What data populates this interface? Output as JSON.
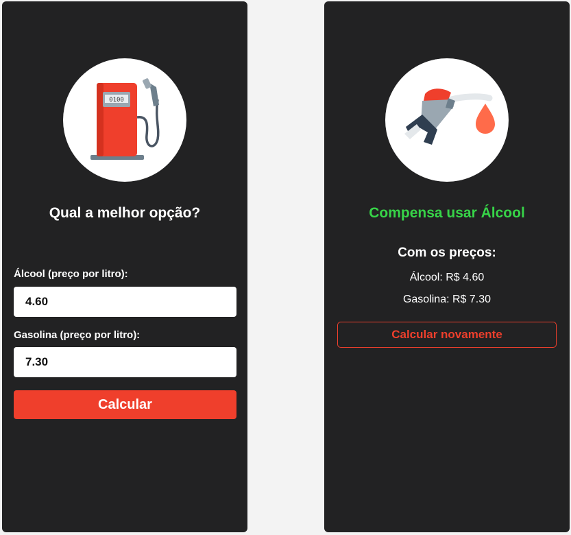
{
  "form_screen": {
    "icon": "gas-pump-icon",
    "pump_display": "0100",
    "title": "Qual a melhor opção?",
    "alcohol_label": "Álcool (preço por litro):",
    "alcohol_value": "4.60",
    "gasoline_label": "Gasolina (preço por litro):",
    "gasoline_value": "7.30",
    "calculate_label": "Calcular"
  },
  "result_screen": {
    "icon": "fuel-nozzle-icon",
    "title": "Compensa usar Álcool",
    "prices_heading": "Com os preços:",
    "alcohol_price": "Álcool: R$ 4.60",
    "gasoline_price": "Gasolina: R$ 7.30",
    "recalculate_label": "Calcular novamente"
  },
  "colors": {
    "card_background": "#222223",
    "page_background": "#f3f3f3",
    "accent": "#ef3f2c",
    "success": "#37d448"
  }
}
